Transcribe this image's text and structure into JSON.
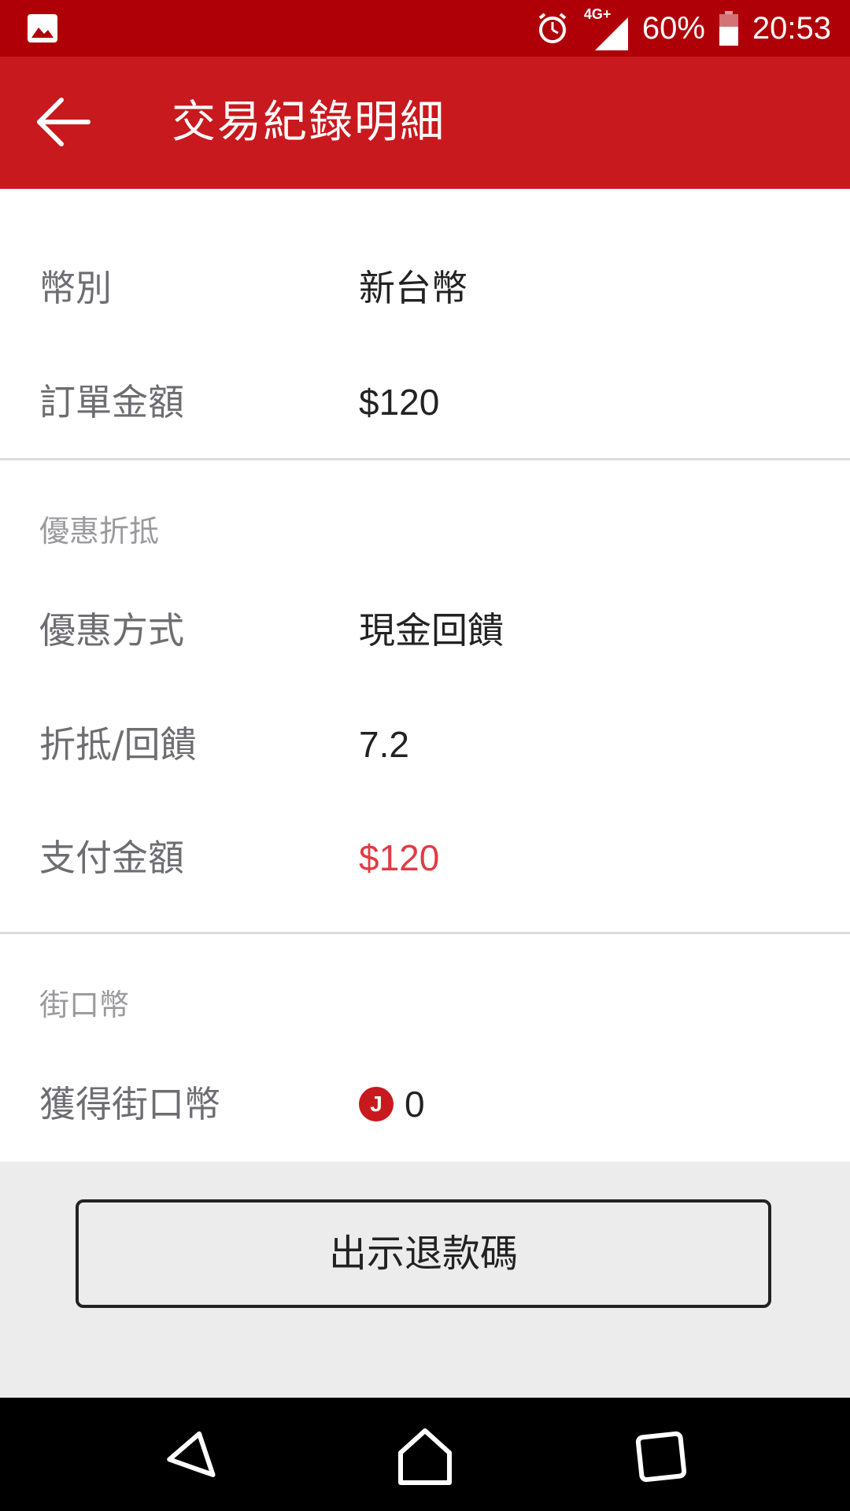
{
  "status_bar": {
    "network": "4G+",
    "battery": "60%",
    "time": "20:53",
    "icons": [
      "image-icon",
      "alarm-icon",
      "signal-icon",
      "battery-icon"
    ]
  },
  "app_bar": {
    "title": "交易紀錄明細",
    "back_icon": "arrow-left-icon"
  },
  "details": {
    "currency": {
      "label": "幣別",
      "value": "新台幣"
    },
    "order_amount": {
      "label": "訂單金額",
      "value": "$120"
    }
  },
  "discount": {
    "section_title": "優惠折抵",
    "method": {
      "label": "優惠方式",
      "value": "現金回饋"
    },
    "rebate": {
      "label": "折抵/回饋",
      "value": "7.2"
    },
    "paid": {
      "label": "支付金額",
      "value": "$120"
    }
  },
  "jkopay_coins": {
    "section_title": "街口幣",
    "earned": {
      "label": "獲得街口幣",
      "icon_letter": "J",
      "value": "0"
    }
  },
  "footer": {
    "refund_button_label": "出示退款碼"
  },
  "colors": {
    "status_bar": "#b00007",
    "app_bar": "#c8191e",
    "accent_red": "#e03c46",
    "footer_bg": "#ececec"
  },
  "nav_bar": {
    "icons": [
      "back-nav-icon",
      "home-nav-icon",
      "recents-nav-icon"
    ]
  }
}
